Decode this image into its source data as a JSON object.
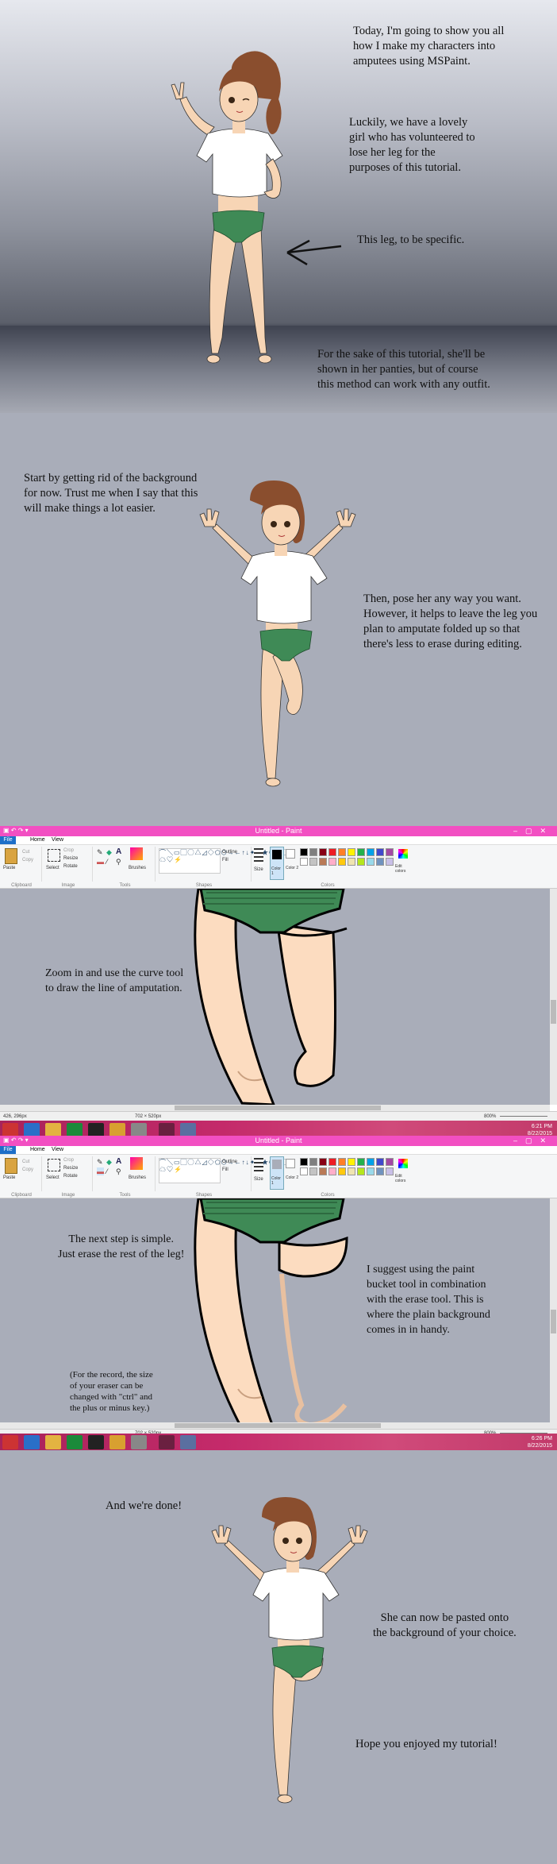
{
  "panel1": {
    "intro": [
      "Today, I'm going to show you all",
      "how I make my characters into",
      "amputees using MSPaint."
    ],
    "volunteer": [
      "Luckily, we have a lovely",
      "girl who has volunteered to",
      "lose her leg for the",
      "purposes of this tutorial."
    ],
    "specific": "This leg, to be specific.",
    "panties": [
      "For the sake of this tutorial, she'll be",
      "shown in her panties, but of course",
      "this method can work with any outfit."
    ]
  },
  "panel2": {
    "background": [
      "Start by getting rid of the background",
      "for now. Trust me when I say that this",
      "will make things a lot easier."
    ],
    "pose": [
      "Then, pose her any way you want.",
      "However, it helps to leave the leg you",
      "plan to amputate folded up so that",
      "there's less to erase during editing."
    ]
  },
  "paint1": {
    "title": "Untitled - Paint",
    "menu": {
      "file": "File",
      "home": "Home",
      "view": "View"
    },
    "groups": {
      "clipboard": "Clipboard",
      "image": "Image",
      "tools": "Tools",
      "shapes": "Shapes",
      "colors": "Colors"
    },
    "tools": {
      "paste": "Paste",
      "cut": "Cut",
      "copy": "Copy",
      "select": "Select",
      "crop": "Crop",
      "resize": "Resize",
      "rotate": "Rotate",
      "brushes": "Brushes",
      "outline": "Outline",
      "fill": "Fill",
      "size": "Size",
      "color1": "Color 1",
      "color2": "Color 2",
      "edit_colors": "Edit colors"
    },
    "caption": [
      "Zoom in and use the curve tool",
      "to draw the line of amputation."
    ],
    "status": {
      "pos": "426, 296px",
      "dims": "702 × 520px",
      "zoom": "800%"
    },
    "clock": {
      "time": "6:21 PM",
      "date": "8/22/2015"
    }
  },
  "paint2": {
    "title": "Untitled - Paint",
    "menu": {
      "file": "File",
      "home": "Home",
      "view": "View"
    },
    "groups": {
      "clipboard": "Clipboard",
      "image": "Image",
      "tools": "Tools",
      "shapes": "Shapes",
      "colors": "Colors"
    },
    "tools": {
      "paste": "Paste",
      "cut": "Cut",
      "copy": "Copy",
      "select": "Select",
      "crop": "Crop",
      "resize": "Resize",
      "rotate": "Rotate",
      "brushes": "Brushes",
      "outline": "Outline",
      "fill": "Fill",
      "size": "Size",
      "color1": "Color 1",
      "color2": "Color 2",
      "edit_colors": "Edit colors"
    },
    "erase": [
      "The next step is simple.",
      "Just erase the rest of the leg!"
    ],
    "bucket": [
      "I suggest using the paint",
      "bucket tool in combination",
      "with the erase tool. This is",
      "where the plain background",
      "comes in in handy."
    ],
    "record": [
      "(For the record, the size",
      "of your eraser can be",
      "changed with \"ctrl\" and",
      "the plus or minus key.)"
    ],
    "status": {
      "pos": "",
      "dims": "702 × 520px",
      "zoom": "800%"
    },
    "clock": {
      "time": "6:26 PM",
      "date": "8/22/2015"
    }
  },
  "panel5": {
    "done": "And we're done!",
    "pasted": [
      "She can now be pasted onto",
      "the background of your choice."
    ],
    "hope": "Hope you enjoyed my tutorial!"
  },
  "palette": [
    "#000000",
    "#7f7f7f",
    "#880015",
    "#ed1c24",
    "#ff7f27",
    "#fff200",
    "#22b14c",
    "#00a2e8",
    "#3f48cc",
    "#a349a4",
    "#ffffff",
    "#c3c3c3",
    "#b97a57",
    "#ffaec9",
    "#ffc90e",
    "#efe4b0",
    "#b5e61d",
    "#99d9ea",
    "#7092be",
    "#c8bfe7"
  ],
  "colors": {
    "paint_title": "#f24fc2",
    "taskbar": "#c42a6a",
    "skin": "#f7d5b5",
    "hair": "#8a4e2e",
    "panties": "#3f8a56"
  }
}
